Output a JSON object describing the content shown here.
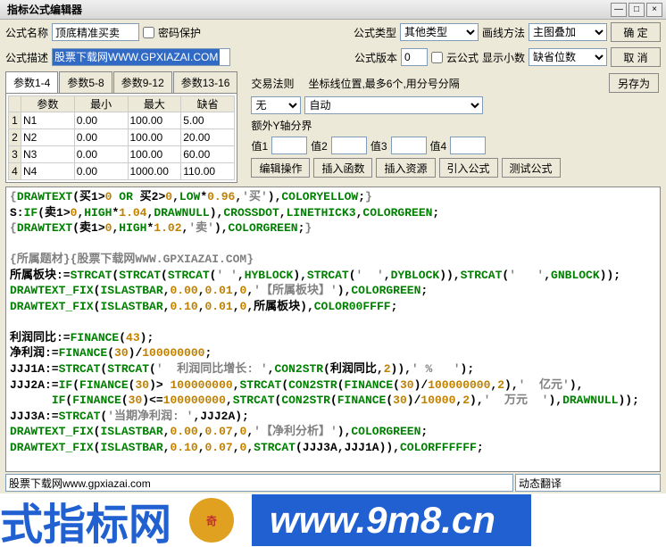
{
  "window": {
    "title": "指标公式编辑器"
  },
  "row1": {
    "name_label": "公式名称",
    "name_value": "顶底精准买卖",
    "pwd_label": "密码保护",
    "type_label": "公式类型",
    "type_value": "其他类型",
    "drawmethod_label": "画线方法",
    "drawmethod_value": "主图叠加",
    "ok": "确  定"
  },
  "row2": {
    "desc_label": "公式描述",
    "desc_value": "股票下载网WWW.GPXIAZAI.COM",
    "version_label": "公式版本",
    "version_value": "0",
    "cloud_label": "云公式",
    "decimal_label": "显示小数",
    "decimal_value": "缺省位数",
    "cancel": "取  消"
  },
  "tabs": [
    "参数1-4",
    "参数5-8",
    "参数9-12",
    "参数13-16"
  ],
  "param_headers": [
    "参数",
    "最小",
    "最大",
    "缺省"
  ],
  "params": [
    {
      "name": "N1",
      "min": "0.00",
      "max": "100.00",
      "def": "5.00"
    },
    {
      "name": "N2",
      "min": "0.00",
      "max": "100.00",
      "def": "20.00"
    },
    {
      "name": "N3",
      "min": "0.00",
      "max": "100.00",
      "def": "60.00"
    },
    {
      "name": "N4",
      "min": "0.00",
      "max": "1000.00",
      "def": "110.00"
    }
  ],
  "right": {
    "trade_rule": "交易法则",
    "coord_hint": "坐标线位置,最多6个,用分号分隔",
    "saveas": "另存为",
    "none": "无",
    "auto": "自动",
    "extra_y": "额外Y轴分界",
    "v1": "值1",
    "v2": "值2",
    "v3": "值3",
    "v4": "值4",
    "btn_edit": "编辑操作",
    "btn_func": "插入函数",
    "btn_res": "插入资源",
    "btn_import": "引入公式",
    "btn_test": "测试公式"
  },
  "bottom": {
    "left": "股票下载网www.gpxiazai.com",
    "right": "动态翻译"
  },
  "watermark": {
    "t1": "式指标网",
    "t2": "www.9m8.cn"
  }
}
